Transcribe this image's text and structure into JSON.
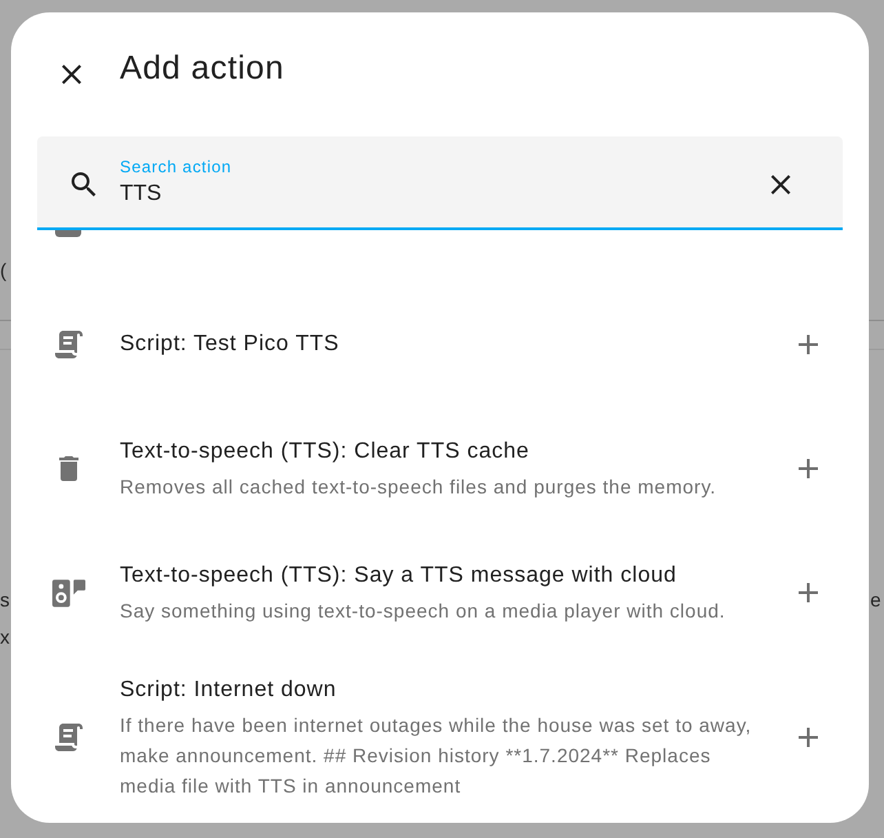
{
  "background": {
    "left_edge": [
      "(",
      "s",
      "x"
    ],
    "right_edge": [
      "e"
    ]
  },
  "dialog": {
    "title": "Add action",
    "search": {
      "label": "Search action",
      "value": "TTS"
    },
    "actions": [
      {
        "kind": "script",
        "title": "Script: Test Pico TTS"
      },
      {
        "kind": "delete",
        "title": "Text-to-speech (TTS): Clear TTS cache",
        "description": "Removes all cached text-to-speech files and purges the memory."
      },
      {
        "kind": "speaker",
        "title": "Text-to-speech (TTS): Say a TTS message with cloud",
        "description": "Say something using text-to-speech on a media player with cloud."
      },
      {
        "kind": "script",
        "title": "Script: Internet down",
        "description": "If there have been internet outages while the house was set to away, make announcement. ## Revision history **1.7.2024** Replaces media file with TTS in announcement"
      }
    ]
  }
}
